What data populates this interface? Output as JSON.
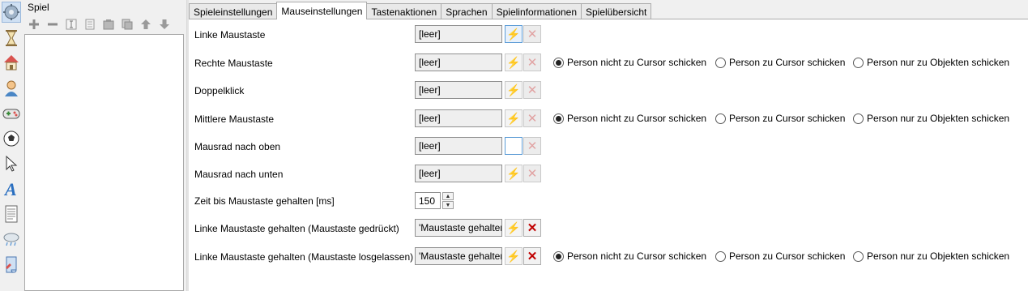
{
  "panel": {
    "title": "Spiel",
    "toolbar": [
      "plus-icon",
      "minus-icon",
      "rename-icon",
      "copy-icon",
      "paste-icon",
      "duplicate-icon",
      "move-up-icon",
      "move-down-icon"
    ]
  },
  "sidebar_icons": [
    "settings-gear-icon",
    "hourglass-icon",
    "house-icon",
    "person-icon",
    "gamepad-icon",
    "ball-icon",
    "cursor-icon",
    "text-a-icon",
    "document-icon",
    "weather-icon",
    "scroll-icon"
  ],
  "tabs": [
    {
      "label": "Spieleinstellungen",
      "active": false
    },
    {
      "label": "Mauseinstellungen",
      "active": true
    },
    {
      "label": "Tastenaktionen",
      "active": false
    },
    {
      "label": "Sprachen",
      "active": false
    },
    {
      "label": "Spielinformationen",
      "active": false
    },
    {
      "label": "Spielübersicht",
      "active": false
    }
  ],
  "radio_options": {
    "opt1": "Person nicht zu Cursor schicken",
    "opt2": "Person zu Cursor schicken",
    "opt3": "Person nur zu Objekten schicken"
  },
  "rows": {
    "r0": {
      "label": "Linke Maustaste",
      "value": "[leer]"
    },
    "r1": {
      "label": "Rechte Maustaste",
      "value": "[leer]"
    },
    "r2": {
      "label": "Doppelklick",
      "value": "[leer]"
    },
    "r3": {
      "label": "Mittlere Maustaste",
      "value": "[leer]"
    },
    "r4": {
      "label": "Mausrad nach oben",
      "value": "[leer]"
    },
    "r5": {
      "label": "Mausrad nach unten",
      "value": "[leer]"
    },
    "r6": {
      "label": "Zeit bis Maustaste gehalten [ms]",
      "value": "150"
    },
    "r7": {
      "label": "Linke Maustaste gehalten (Maustaste gedrückt)",
      "value": "'Maustaste gehalten'"
    },
    "r8": {
      "label": "Linke Maustaste gehalten (Maustaste losgelassen)",
      "value": "'Maustaste gehalten'"
    }
  },
  "bolt_glyph": "⚡",
  "x_glyph": "✕",
  "spinner": {
    "up": "▲",
    "down": "▼"
  }
}
